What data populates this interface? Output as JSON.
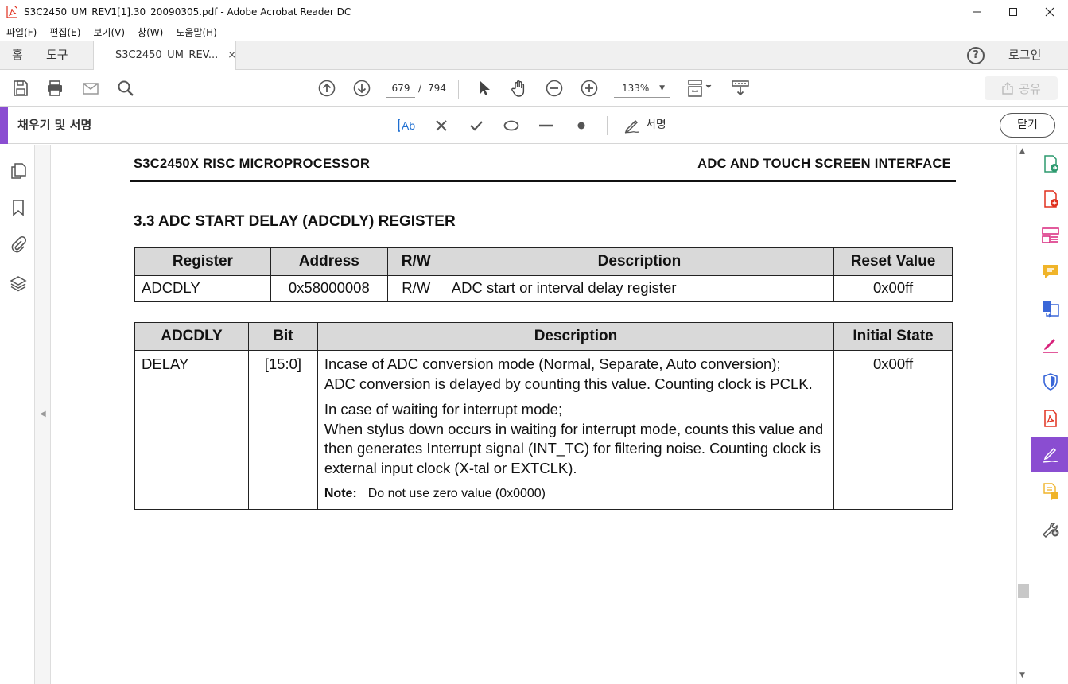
{
  "window": {
    "title": "S3C2450_UM_REV1[1].30_20090305.pdf - Adobe Acrobat Reader DC",
    "app_icon": "acrobat-pdf-icon",
    "controls": [
      "minimize",
      "maximize",
      "close"
    ]
  },
  "menubar": {
    "items": [
      "파일(F)",
      "편집(E)",
      "보기(V)",
      "창(W)",
      "도움말(H)"
    ]
  },
  "tabs": {
    "home": "홈",
    "tools": "도구",
    "document": "S3C2450_UM_REV...",
    "close_glyph": "×",
    "help_glyph": "?",
    "login": "로그인"
  },
  "toolbar": {
    "current_page": "679",
    "page_separator": "/",
    "total_pages": "794",
    "zoom": "133%",
    "share": "공유",
    "icons": [
      "save-icon",
      "print-icon",
      "email-icon",
      "search-icon",
      "page-up-icon",
      "page-down-icon",
      "select-cursor-icon",
      "hand-tool-icon",
      "zoom-out-icon",
      "zoom-in-icon",
      "page-display-icon",
      "scroll-mode-icon"
    ]
  },
  "fill_sign": {
    "title": "채우기 및 서명",
    "text_tool_label": "Ab",
    "sign_label": "서명",
    "close": "닫기",
    "tools": [
      "add-text-icon",
      "cross-mark-icon",
      "check-mark-icon",
      "ellipse-icon",
      "line-icon",
      "dot-icon",
      "sign-pen-icon"
    ]
  },
  "left_nav": [
    "page-thumbnails-icon",
    "bookmarks-icon",
    "attachments-icon",
    "layers-icon"
  ],
  "right_rail": [
    "export-pdf-icon",
    "create-pdf-icon",
    "organize-pages-icon",
    "comment-icon",
    "combine-files-icon",
    "fill-sign-pen-icon",
    "protect-shield-icon",
    "edit-pdf-icon",
    "fill-sign-active-icon",
    "send-for-review-icon",
    "more-tools-icon"
  ],
  "document": {
    "header_left": "S3C2450X RISC MICROPROCESSOR",
    "header_right": "ADC AND TOUCH SCREEN INTERFACE",
    "section_title": "3.3  ADC START DELAY (ADCDLY) REGISTER",
    "register_table": {
      "headers": [
        "Register",
        "Address",
        "R/W",
        "Description",
        "Reset Value"
      ],
      "row": [
        "ADCDLY",
        "0x58000008",
        "R/W",
        "ADC start or interval delay register",
        "0x00ff"
      ]
    },
    "bit_table": {
      "headers": [
        "ADCDLY",
        "Bit",
        "Description",
        "Initial State"
      ],
      "row": {
        "field": "DELAY",
        "bit": "[15:0]",
        "desc_p1_line1": "Incase of ADC conversion mode (Normal, Separate, Auto conversion);",
        "desc_p1_line2": "ADC conversion is delayed by counting this value. Counting clock is PCLK.",
        "desc_p2_line1": "In case of waiting for interrupt mode;",
        "desc_p2_line2": "When stylus down occurs in waiting for interrupt mode, counts this value and then generates Interrupt signal (INT_TC) for filtering noise. Counting clock is external input clock (X-tal or EXTCLK).",
        "note_label": "Note:",
        "note_text": "Do not use zero value (0x0000)",
        "initial": "0x00ff"
      }
    }
  },
  "colors": {
    "accent_purple": "#8a4dd1",
    "text_tool_blue": "#1f6fd1",
    "table_header_gray": "#d9d9d9"
  }
}
